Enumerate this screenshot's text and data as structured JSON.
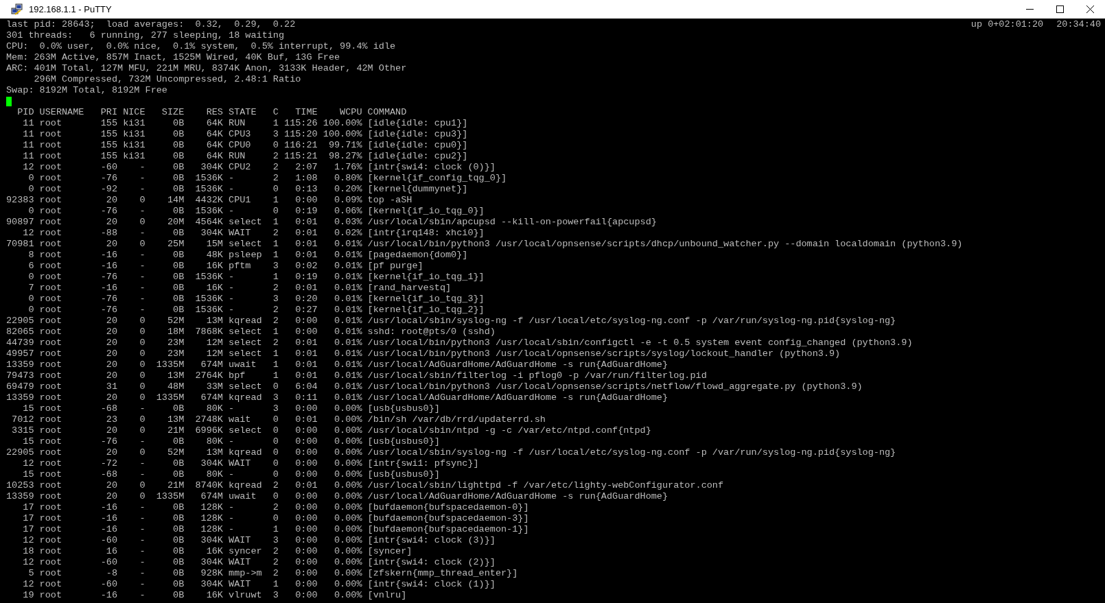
{
  "window": {
    "title": "192.168.1.1 - PuTTY"
  },
  "terminal": {
    "first_line": "last pid: 28643;  load averages:  0.32,  0.29,  0.22",
    "uptime": "up 0+02:01:20",
    "clock": "20:34:40",
    "summary_lines": [
      "301 threads:   6 running, 277 sleeping, 18 waiting",
      "CPU:  0.0% user,  0.0% nice,  0.1% system,  0.5% interrupt, 99.4% idle",
      "Mem: 263M Active, 857M Inact, 1525M Wired, 40K Buf, 13G Free",
      "ARC: 401M Total, 127M MFU, 221M MRU, 8374K Anon, 3133K Header, 42M Other",
      "     296M Compressed, 732M Uncompressed, 2.48:1 Ratio",
      "Swap: 8192M Total, 8192M Free"
    ],
    "table_header": "  PID USERNAME   PRI NICE   SIZE    RES STATE   C   TIME    WCPU COMMAND",
    "process_lines": [
      "   11 root       155 ki31     0B    64K RUN     1 115:26 100.00% [idle{idle: cpu1}]",
      "   11 root       155 ki31     0B    64K CPU3    3 115:20 100.00% [idle{idle: cpu3}]",
      "   11 root       155 ki31     0B    64K CPU0    0 116:21  99.71% [idle{idle: cpu0}]",
      "   11 root       155 ki31     0B    64K RUN     2 115:21  98.27% [idle{idle: cpu2}]",
      "   12 root       -60    -     0B   304K CPU2    2   2:07   1.76% [intr{swi4: clock (0)}]",
      "    0 root       -76    -     0B  1536K -       2   1:08   0.80% [kernel{if_config_tqg_0}]",
      "    0 root       -92    -     0B  1536K -       0   0:13   0.20% [kernel{dummynet}]",
      "92383 root        20    0    14M  4432K CPU1    1   0:00   0.09% top -aSH",
      "    0 root       -76    -     0B  1536K -       0   0:19   0.06% [kernel{if_io_tqg_0}]",
      "90897 root        20    0    20M  4564K select  1   0:01   0.03% /usr/local/sbin/apcupsd --kill-on-powerfail{apcupsd}",
      "   12 root       -88    -     0B   304K WAIT    2   0:01   0.02% [intr{irq148: xhci0}]",
      "70981 root        20    0    25M    15M select  1   0:01   0.01% /usr/local/bin/python3 /usr/local/opnsense/scripts/dhcp/unbound_watcher.py --domain localdomain (python3.9)",
      "    8 root       -16    -     0B    48K psleep  1   0:01   0.01% [pagedaemon{dom0}]",
      "    6 root       -16    -     0B    16K pftm    3   0:02   0.01% [pf purge]",
      "    0 root       -76    -     0B  1536K -       1   0:19   0.01% [kernel{if_io_tqg_1}]",
      "    7 root       -16    -     0B    16K -       2   0:01   0.01% [rand_harvestq]",
      "    0 root       -76    -     0B  1536K -       3   0:20   0.01% [kernel{if_io_tqg_3}]",
      "    0 root       -76    -     0B  1536K -       2   0:27   0.01% [kernel{if_io_tqg_2}]",
      "22905 root        20    0    52M    13M kqread  2   0:00   0.01% /usr/local/sbin/syslog-ng -f /usr/local/etc/syslog-ng.conf -p /var/run/syslog-ng.pid{syslog-ng}",
      "82065 root        20    0    18M  7868K select  1   0:00   0.01% sshd: root@pts/0 (sshd)",
      "44739 root        20    0    23M    12M select  2   0:01   0.01% /usr/local/bin/python3 /usr/local/sbin/configctl -e -t 0.5 system event config_changed (python3.9)",
      "49957 root        20    0    23M    12M select  1   0:01   0.01% /usr/local/bin/python3 /usr/local/opnsense/scripts/syslog/lockout_handler (python3.9)",
      "13359 root        20    0  1335M   674M uwait   1   0:01   0.01% /usr/local/AdGuardHome/AdGuardHome -s run{AdGuardHome}",
      "79473 root        20    0    13M  2764K bpf     1   0:01   0.01% /usr/local/sbin/filterlog -i pflog0 -p /var/run/filterlog.pid",
      "69479 root        31    0    48M    33M select  0   6:04   0.01% /usr/local/bin/python3 /usr/local/opnsense/scripts/netflow/flowd_aggregate.py (python3.9)",
      "13359 root        20    0  1335M   674M kqread  3   0:11   0.01% /usr/local/AdGuardHome/AdGuardHome -s run{AdGuardHome}",
      "   15 root       -68    -     0B    80K -       3   0:00   0.00% [usb{usbus0}]",
      " 7012 root        23    0    13M  2748K wait    0   0:01   0.00% /bin/sh /var/db/rrd/updaterrd.sh",
      " 3315 root        20    0    21M  6996K select  0   0:00   0.00% /usr/local/sbin/ntpd -g -c /var/etc/ntpd.conf{ntpd}",
      "   15 root       -76    -     0B    80K -       0   0:00   0.00% [usb{usbus0}]",
      "22905 root        20    0    52M    13M kqread  0   0:00   0.00% /usr/local/sbin/syslog-ng -f /usr/local/etc/syslog-ng.conf -p /var/run/syslog-ng.pid{syslog-ng}",
      "   12 root       -72    -     0B   304K WAIT    0   0:00   0.00% [intr{swi1: pfsync}]",
      "   15 root       -68    -     0B    80K -       0   0:00   0.00% [usb{usbus0}]",
      "10253 root        20    0    21M  8740K kqread  2   0:01   0.00% /usr/local/sbin/lighttpd -f /var/etc/lighty-webConfigurator.conf",
      "13359 root        20    0  1335M   674M uwait   0   0:00   0.00% /usr/local/AdGuardHome/AdGuardHome -s run{AdGuardHome}",
      "   17 root       -16    -     0B   128K -       2   0:00   0.00% [bufdaemon{bufspacedaemon-0}]",
      "   17 root       -16    -     0B   128K -       0   0:00   0.00% [bufdaemon{bufspacedaemon-3}]",
      "   17 root       -16    -     0B   128K -       1   0:00   0.00% [bufdaemon{bufspacedaemon-1}]",
      "   12 root       -60    -     0B   304K WAIT    3   0:00   0.00% [intr{swi4: clock (3)}]",
      "   18 root        16    -     0B    16K syncer  2   0:00   0.00% [syncer]",
      "   12 root       -60    -     0B   304K WAIT    2   0:00   0.00% [intr{swi4: clock (2)}]",
      "    5 root        -8    -     0B   928K mmp->m  2   0:00   0.00% [zfskern{mmp_thread_enter}]",
      "   12 root       -60    -     0B   304K WAIT    1   0:00   0.00% [intr{swi4: clock (1)}]",
      "   19 root       -16    -     0B    16K vlruwt  3   0:00   0.00% [vnlru]"
    ]
  }
}
